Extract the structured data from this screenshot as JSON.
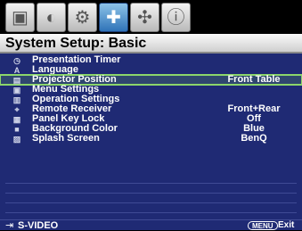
{
  "tabs": [
    {
      "icon": "picture-icon",
      "glyph": "▣"
    },
    {
      "icon": "display-adjust-icon",
      "glyph": "◐"
    },
    {
      "icon": "source-settings-icon",
      "glyph": "⚙"
    },
    {
      "icon": "system-setup-basic-icon",
      "glyph": "✚",
      "active": true
    },
    {
      "icon": "system-setup-advanced-icon",
      "glyph": "✣"
    },
    {
      "icon": "information-icon",
      "glyph": "ⓘ"
    }
  ],
  "title": "System Setup: Basic",
  "menu": [
    {
      "label": "Presentation Timer",
      "value": "",
      "icon": "timer-icon",
      "glyph": "◷"
    },
    {
      "label": "Language",
      "value": "",
      "icon": "language-icon",
      "glyph": "A"
    },
    {
      "label": "Projector Position",
      "value": "Front Table",
      "icon": "projector-icon",
      "glyph": "▤",
      "selected": true
    },
    {
      "label": "Menu Settings",
      "value": "",
      "icon": "menu-settings-icon",
      "glyph": "▣"
    },
    {
      "label": "Operation Settings",
      "value": "",
      "icon": "operation-settings-icon",
      "glyph": "▥"
    },
    {
      "label": "Remote Receiver",
      "value": "Front+Rear",
      "icon": "remote-receiver-icon",
      "glyph": "⌖"
    },
    {
      "label": "Panel Key Lock",
      "value": "Off",
      "icon": "lock-icon",
      "glyph": "▦"
    },
    {
      "label": "Background Color",
      "value": "Blue",
      "icon": "background-color-icon",
      "glyph": "■"
    },
    {
      "label": "Splash Screen",
      "value": "BenQ",
      "icon": "splash-screen-icon",
      "glyph": "▨"
    }
  ],
  "footer": {
    "source_icon": "input-source-icon",
    "source_glyph": "⇥",
    "source": "S-VIDEO",
    "menu_badge": "MENU",
    "exit": "Exit"
  },
  "colors": {
    "background": "#1f2a74",
    "selected_outline": "#8cd66b",
    "active_tab": "#2f73b8"
  }
}
